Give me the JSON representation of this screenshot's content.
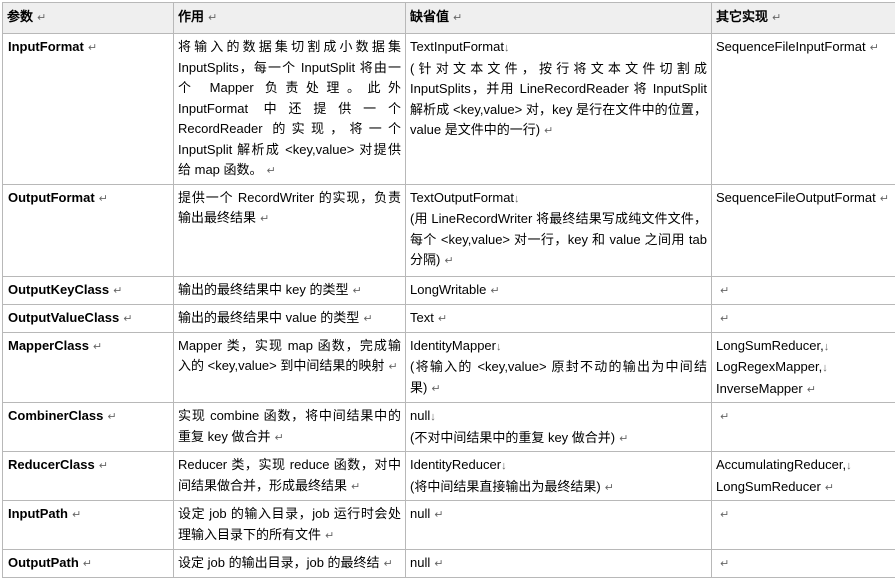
{
  "headers": [
    "参数",
    "作用",
    "缺省值",
    "其它实现"
  ],
  "rows": [
    {
      "param": "InputFormat",
      "desc": "将输入的数据集切割成小数据集 InputSplits，每一个 InputSplit 将由一个 Mapper 负责处理。此外 InputFormat 中还提供一个 RecordReader 的实现，将一个 InputSplit 解析成 <key,value> 对提供给 map 函数。",
      "default_lines": [
        "TextInputFormat",
        "(针对文本文件，按行将文本文件切割成 InputSplits，并用 LineRecordReader 将 InputSplit 解析成 <key,value> 对，key 是行在文件中的位置，value 是文件中的一行)"
      ],
      "others": [
        "SequenceFileInputFormat"
      ]
    },
    {
      "param": "OutputFormat",
      "desc": "提供一个 RecordWriter 的实现，负责输出最终结果",
      "default_lines": [
        "TextOutputFormat",
        "(用 LineRecordWriter 将最终结果写成纯文件文件，每个 <key,value> 对一行，key 和 value 之间用 tab 分隔)"
      ],
      "others": [
        "SequenceFileOutputFormat"
      ]
    },
    {
      "param": "OutputKeyClass",
      "desc": "输出的最终结果中 key 的类型",
      "default_lines": [
        "LongWritable"
      ],
      "others": []
    },
    {
      "param": "OutputValueClass",
      "desc": "输出的最终结果中 value 的类型",
      "default_lines": [
        "Text"
      ],
      "others": []
    },
    {
      "param": "MapperClass",
      "desc": "Mapper 类，实现 map 函数，完成输入的 <key,value> 到中间结果的映射",
      "default_lines": [
        "IdentityMapper",
        "(将输入的 <key,value> 原封不动的输出为中间结果)"
      ],
      "others": [
        "LongSumReducer,",
        "LogRegexMapper,",
        "InverseMapper"
      ]
    },
    {
      "param": "CombinerClass",
      "desc": "实现 combine 函数，将中间结果中的重复 key 做合并",
      "default_lines": [
        "null",
        "(不对中间结果中的重复 key 做合并)"
      ],
      "others": []
    },
    {
      "param": "ReducerClass",
      "desc": "Reducer 类，实现 reduce 函数，对中间结果做合并，形成最终结果",
      "default_lines": [
        "IdentityReducer",
        "(将中间结果直接输出为最终结果)"
      ],
      "others": [
        "AccumulatingReducer,",
        "LongSumReducer"
      ]
    },
    {
      "param": "InputPath",
      "desc": "设定 job 的输入目录，job 运行时会处理输入目录下的所有文件",
      "default_lines": [
        "null"
      ],
      "others": []
    },
    {
      "param": "OutputPath",
      "desc": "设定 job 的输出目录，job 的最终结",
      "default_lines": [
        "null"
      ],
      "others": []
    }
  ],
  "marks": {
    "para": "↵",
    "line": "↓"
  }
}
